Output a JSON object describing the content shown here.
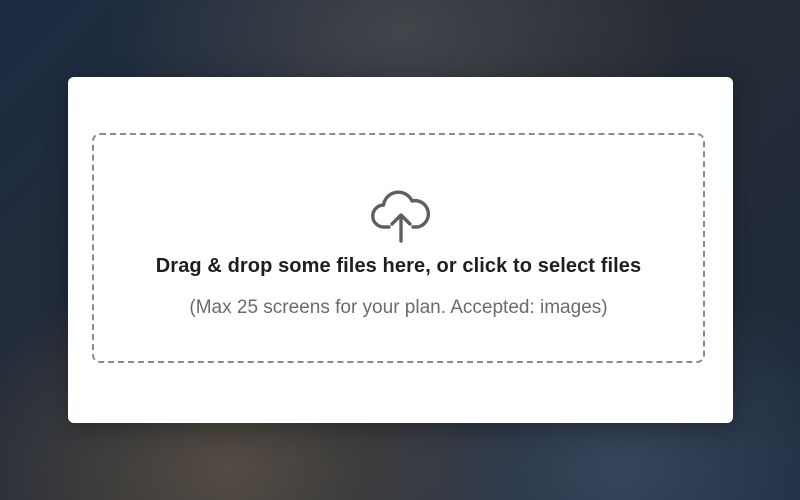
{
  "dropzone": {
    "icon": "cloud-upload-icon",
    "title": "Drag & drop some files here, or click to select files",
    "subtitle": "(Max 25 screens for your plan. Accepted: images)"
  },
  "colors": {
    "card_background": "#ffffff",
    "dashed_border": "#8a8a8a",
    "title_text": "#1e1e1e",
    "subtitle_text": "#6b6b6b",
    "icon": "#5f5f5f"
  }
}
